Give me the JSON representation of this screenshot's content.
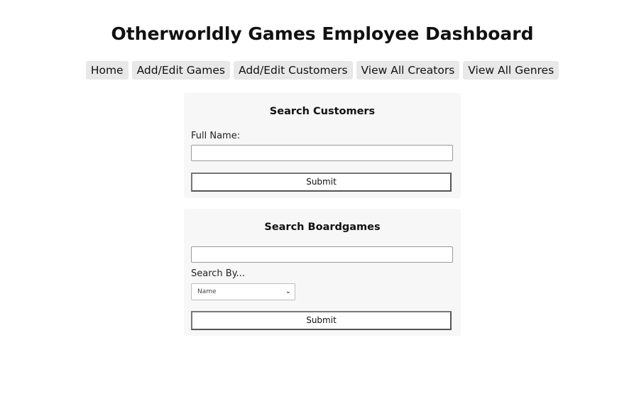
{
  "header": {
    "title": "Otherworldly Games Employee Dashboard"
  },
  "nav": {
    "items": [
      {
        "label": "Home"
      },
      {
        "label": "Add/Edit Games"
      },
      {
        "label": "Add/Edit Customers"
      },
      {
        "label": "View All Creators"
      },
      {
        "label": "View All Genres"
      }
    ]
  },
  "search_customers": {
    "title": "Search Customers",
    "full_name_label": "Full Name:",
    "full_name_value": "",
    "submit_label": "Submit"
  },
  "search_boardgames": {
    "title": "Search Boardgames",
    "query_value": "",
    "search_by_label": "Search By...",
    "search_by_selected": "Name",
    "submit_label": "Submit",
    "chevron_icon": "chevron-down-icon"
  }
}
